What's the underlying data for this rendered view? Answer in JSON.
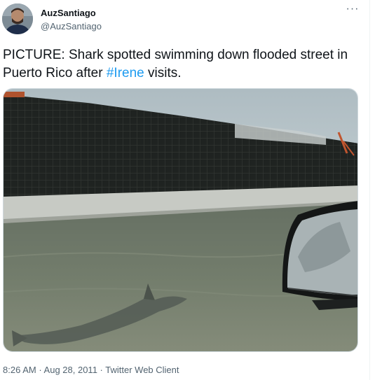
{
  "author": {
    "display_name": "AuzSantiago",
    "handle": "@AuzSantiago"
  },
  "menu": {
    "more_label": "···"
  },
  "tweet": {
    "text_before": "PICTURE: Shark spotted swimming down flooded street in Puerto Rico after ",
    "hashtag": "#Irene",
    "text_after": " visits."
  },
  "meta": {
    "time": "8:26 AM",
    "separator_1": " · ",
    "date": "Aug 28, 2011",
    "separator_2": " · ",
    "source": "Twitter Web Client"
  },
  "colors": {
    "link": "#1d9bf0",
    "secondary_text": "#536471",
    "primary_text": "#0f1419"
  }
}
